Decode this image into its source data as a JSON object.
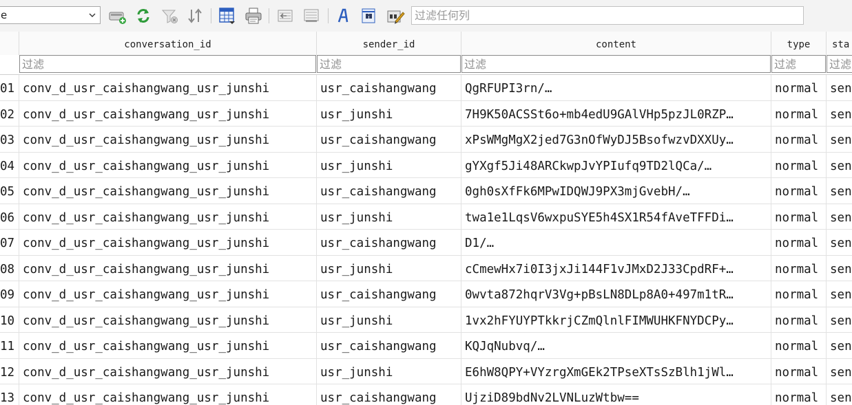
{
  "toolbar": {
    "combo_value": "e",
    "filter_all_placeholder": "过滤任何列"
  },
  "columns": [
    {
      "key": "rowid",
      "label": ""
    },
    {
      "key": "conversation_id",
      "label": "conversation_id"
    },
    {
      "key": "sender_id",
      "label": "sender_id"
    },
    {
      "key": "content",
      "label": "content"
    },
    {
      "key": "type",
      "label": "type"
    },
    {
      "key": "status",
      "label": "sta"
    }
  ],
  "filter_placeholder": "过滤",
  "rows": [
    {
      "rowid": "01",
      "conversation_id": "conv_d_usr_caishangwang_usr_junshi",
      "sender_id": "usr_caishangwang",
      "content": "QgRFUPI3rn/…",
      "type": "normal",
      "status": "sen"
    },
    {
      "rowid": "02",
      "conversation_id": "conv_d_usr_caishangwang_usr_junshi",
      "sender_id": "usr_junshi",
      "content": "7H9K50ACSSt6o+mb4edU9GAlVHp5pzJL0RZP…",
      "type": "normal",
      "status": "sen"
    },
    {
      "rowid": "03",
      "conversation_id": "conv_d_usr_caishangwang_usr_junshi",
      "sender_id": "usr_caishangwang",
      "content": "xPsWMgMgX2jed7G3nOfWyDJ5BsofwzvDXXUy…",
      "type": "normal",
      "status": "sen"
    },
    {
      "rowid": "04",
      "conversation_id": "conv_d_usr_caishangwang_usr_junshi",
      "sender_id": "usr_junshi",
      "content": "gYXgf5Ji48ARCkwpJvYPIufq9TD2lQCa/…",
      "type": "normal",
      "status": "sen"
    },
    {
      "rowid": "05",
      "conversation_id": "conv_d_usr_caishangwang_usr_junshi",
      "sender_id": "usr_caishangwang",
      "content": "0gh0sXfFk6MPwIDQWJ9PX3mjGvebH/…",
      "type": "normal",
      "status": "sen"
    },
    {
      "rowid": "06",
      "conversation_id": "conv_d_usr_caishangwang_usr_junshi",
      "sender_id": "usr_junshi",
      "content": "twa1e1LqsV6wxpuSYE5h4SX1R54fAveTFFDi…",
      "type": "normal",
      "status": "sen"
    },
    {
      "rowid": "07",
      "conversation_id": "conv_d_usr_caishangwang_usr_junshi",
      "sender_id": "usr_caishangwang",
      "content": "D1/…",
      "type": "normal",
      "status": "sen"
    },
    {
      "rowid": "08",
      "conversation_id": "conv_d_usr_caishangwang_usr_junshi",
      "sender_id": "usr_junshi",
      "content": "cCmewHx7i0I3jxJi144F1vJMxD2J33CpdRF+…",
      "type": "normal",
      "status": "sen"
    },
    {
      "rowid": "09",
      "conversation_id": "conv_d_usr_caishangwang_usr_junshi",
      "sender_id": "usr_caishangwang",
      "content": "0wvta872hqrV3Vg+pBsLN8DLp8A0+497m1tR…",
      "type": "normal",
      "status": "sen"
    },
    {
      "rowid": "10",
      "conversation_id": "conv_d_usr_caishangwang_usr_junshi",
      "sender_id": "usr_junshi",
      "content": "1vx2hFYUYPTkkrjCZmQlnlFIMWUHKFNYDCPy…",
      "type": "normal",
      "status": "sen"
    },
    {
      "rowid": "11",
      "conversation_id": "conv_d_usr_caishangwang_usr_junshi",
      "sender_id": "usr_caishangwang",
      "content": "KQJqNubvq/…",
      "type": "normal",
      "status": "sen"
    },
    {
      "rowid": "12",
      "conversation_id": "conv_d_usr_caishangwang_usr_junshi",
      "sender_id": "usr_junshi",
      "content": "E6hW8QPY+VYzrgXmGEk2TPseXTsSzBlh1jWl…",
      "type": "normal",
      "status": "sen"
    },
    {
      "rowid": "13",
      "conversation_id": "conv_d_usr_caishangwang_usr_junshi",
      "sender_id": "usr_caishangwang",
      "content": "UjziD89bdNv2LVNLuzWtbw==",
      "type": "normal",
      "status": "sen"
    }
  ],
  "icons": {
    "insert_record": "insert-record-icon",
    "refresh": "refresh-icon",
    "clear_filters": "clear-filters-icon",
    "sort": "sort-icon",
    "save_table": "save-table-icon",
    "print": "print-icon",
    "export": "export-icon",
    "import": "import-icon",
    "font": "font-icon",
    "find": "find-icon",
    "edit_pragmas": "edit-pragmas-icon"
  },
  "colors": {
    "accent": "#2e5fbf",
    "green": "#2f9b3a",
    "grid_line": "#e2e2e2"
  }
}
